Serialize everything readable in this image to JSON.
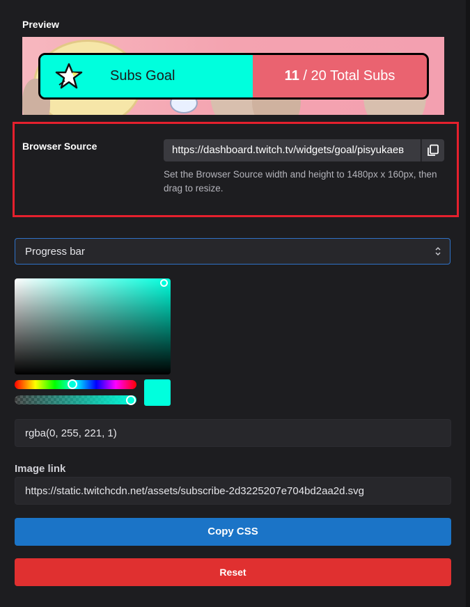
{
  "preview": {
    "label": "Preview",
    "goal": {
      "title": "Subs Goal",
      "current": "11",
      "rest": " / 20 Total Subs",
      "progress": 0.55,
      "bar_color": "#00ffdd",
      "remaining_color": "#ea6370",
      "icon": "star-icon"
    }
  },
  "browser_source": {
    "label": "Browser Source",
    "url": "https://dashboard.twitch.tv/widgets/goal/pisyukaeв",
    "copy_icon": "copy-icon",
    "hint": "Set the Browser Source width and height to 1480px x 160px, then drag to resize.",
    "highlight_color": "#e5202d"
  },
  "style_select": {
    "value": "Progress bar",
    "icon": "chevron-up-down-icon"
  },
  "color_picker": {
    "color": "#00ffdd",
    "hue": 0.48,
    "alpha": 1.0,
    "rgba_value": "rgba(0, 255, 221, 1)"
  },
  "image_link": {
    "label": "Image link",
    "value": "https://static.twitchcdn.net/assets/subscribe-2d3225207e704bd2aa2d.svg"
  },
  "actions": {
    "copy_css": "Copy CSS",
    "reset": "Reset",
    "copy_css_color": "#1b74c7",
    "reset_color": "#e03030"
  }
}
